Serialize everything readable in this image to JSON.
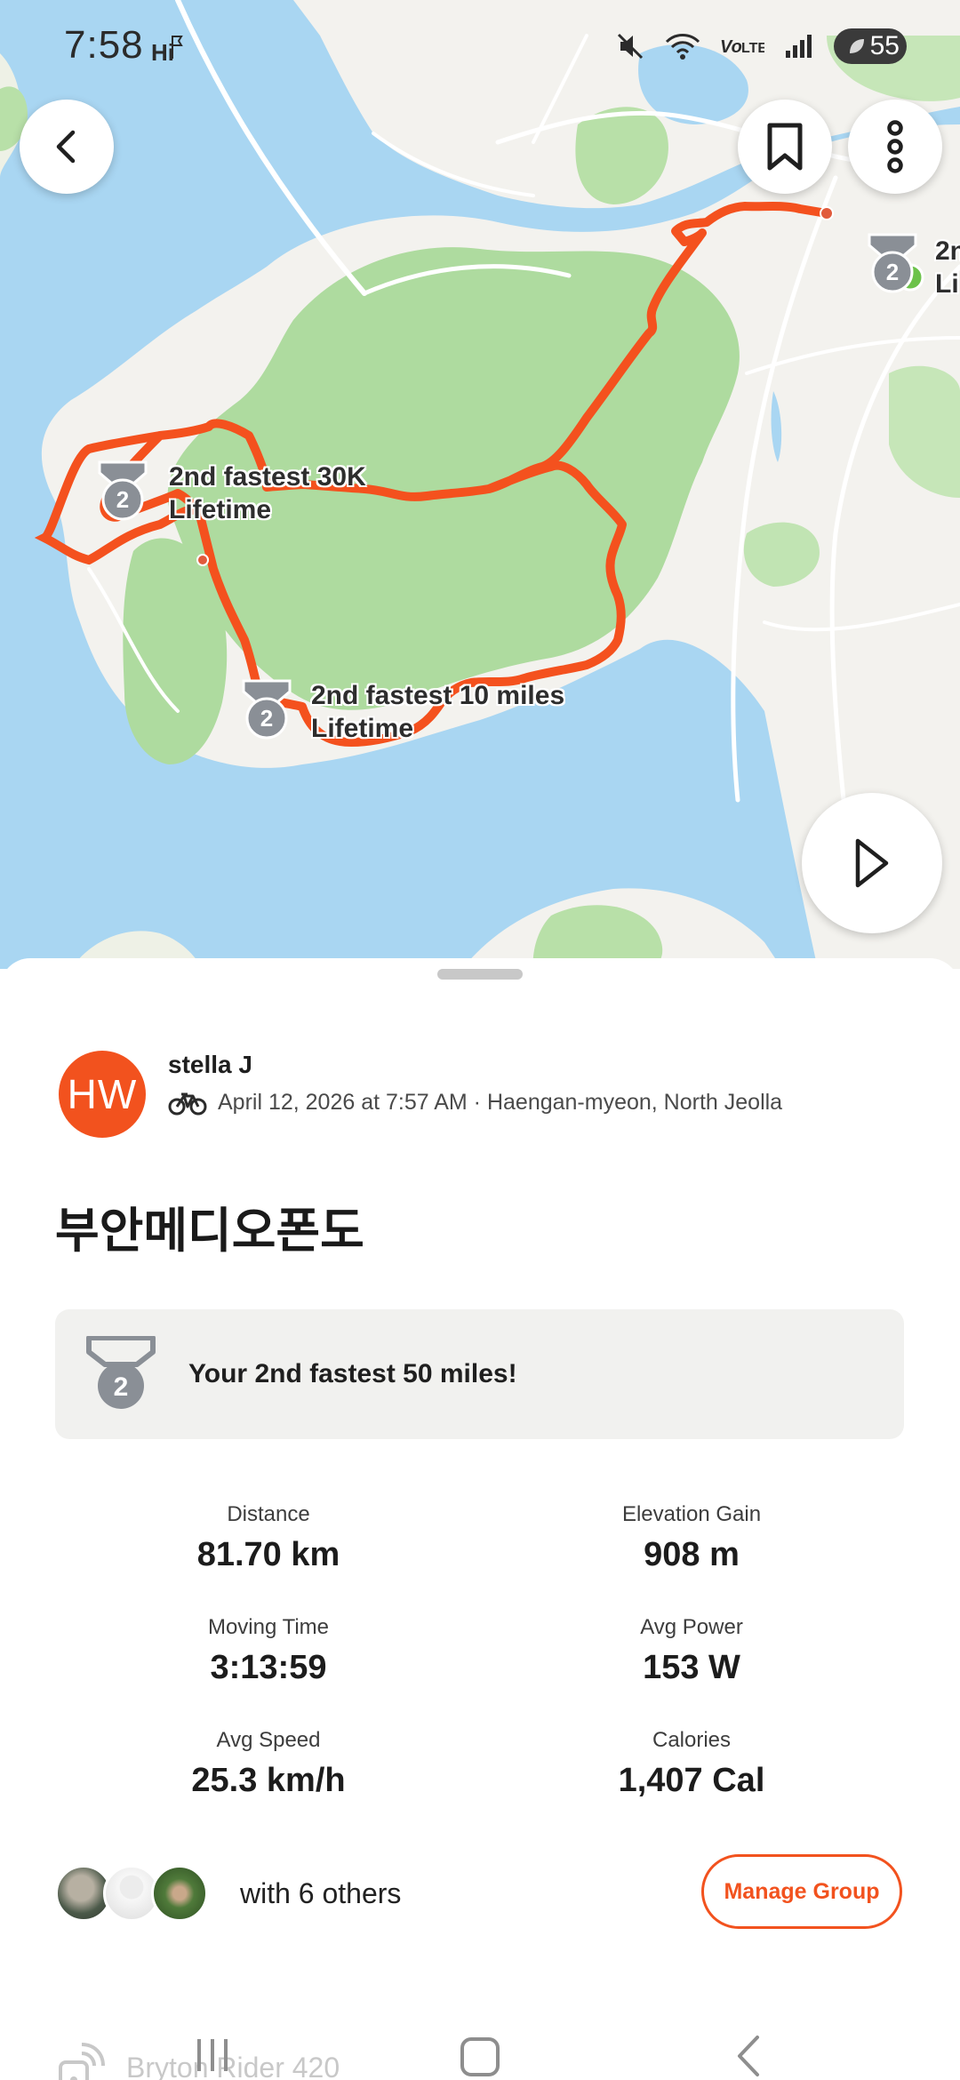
{
  "status_bar": {
    "time": "7:58",
    "indicator": "Hi",
    "battery": "55"
  },
  "map": {
    "labels": {
      "marker_30k": [
        "2nd fastest 30K",
        "Lifetime"
      ],
      "marker_10mi": [
        "2nd fastest 10 miles",
        "Lifetime"
      ],
      "marker_edge": [
        "2n",
        "Li"
      ]
    },
    "medal_rank": "2",
    "route_color": "#f4511e"
  },
  "activity": {
    "avatar_initials": "HW",
    "athlete_name": "stella J",
    "meta": "April 12, 2026 at 7:57 AM · Haengan-myeon, North Jeolla",
    "title": "부안메디오폰도",
    "achievement": "Your 2nd fastest 50 miles!",
    "stats": [
      {
        "label": "Distance",
        "value": "81.70 km"
      },
      {
        "label": "Elevation Gain",
        "value": "908 m"
      },
      {
        "label": "Moving Time",
        "value": "3:13:59"
      },
      {
        "label": "Avg Power",
        "value": "153 W"
      },
      {
        "label": "Avg Speed",
        "value": "25.3 km/h"
      },
      {
        "label": "Calories",
        "value": "1,407 Cal"
      }
    ],
    "group_text": "with 6 others",
    "manage_group_label": "Manage Group",
    "device_name": "Bryton Rider 420",
    "accent_color": "#f2521e"
  }
}
